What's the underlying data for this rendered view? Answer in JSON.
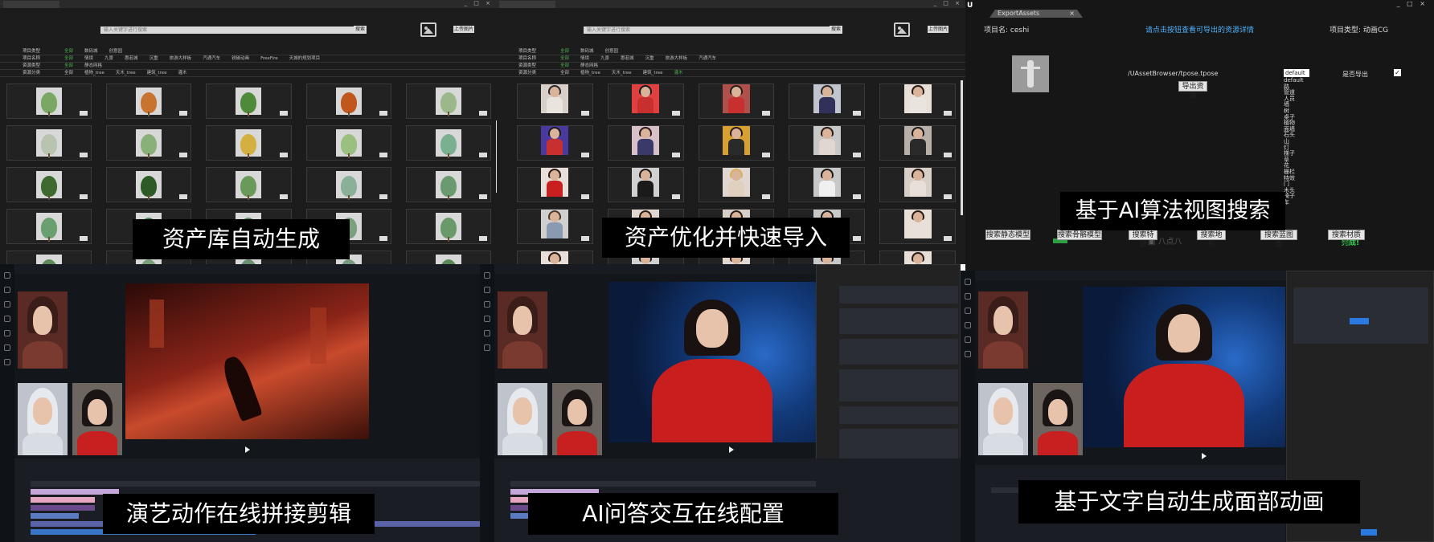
{
  "captions": {
    "c1": "资产库自动生成",
    "c2": "资产优化并快速导入",
    "c3": "基于AI算法视图搜索",
    "c4": "演艺动作在线拼接剪辑",
    "c5": "AI问答交互在线配置",
    "c6": "基于文字自动生成面部动画"
  },
  "library": {
    "search_placeholder": "输入关键字进行搜索",
    "search_button": "搜索",
    "upload_button": "上传图片",
    "filters": [
      {
        "label": "项目类型",
        "options": [
          "全部",
          "数码城",
          "创意园"
        ]
      },
      {
        "label": "项目名称",
        "options": [
          "全部",
          "情境",
          "九景",
          "惠若城",
          "沉重",
          "旅游大样板",
          "汽通汽车",
          "锐碳动画",
          "FreeFire",
          "天城的规划项目"
        ]
      },
      {
        "label": "资源类型",
        "options": [
          "全部",
          "静态网格"
        ]
      },
      {
        "label": "资源分类",
        "options": [
          "全部",
          "植物_tree",
          "天木_tree",
          "建筑_tree",
          "灌木"
        ]
      }
    ]
  },
  "export_assets": {
    "tab_title": "ExportAssets",
    "tab_close": "×",
    "project_name": "项目名: ceshi",
    "hint": "请点击按钮查看可导出的资源详情",
    "project_type": "项目类型: 动画CG",
    "asset_path": "/UAssetBrowser/tpose.tpose",
    "dropdown_value": "default",
    "dropdown_options": [
      "default",
      "路",
      "管道",
      "人员",
      "墙",
      "树",
      "桌子",
      "植物",
      "面墙",
      "石头",
      "山",
      "灯",
      "梯子",
      "草",
      "花",
      "栅栏",
      "特效",
      "门",
      "木头",
      "椅子",
      "车"
    ],
    "export_check_label": "是否导出",
    "check_mark": "✓",
    "export_button": "导出资源",
    "done_text": "完成!",
    "search_buttons": [
      "搜索静态模型",
      "搜索骨骼模型",
      "搜索特效",
      "搜索地形",
      "搜索蓝图类",
      "搜索材质包"
    ]
  },
  "window": {
    "controls": "_ □ ×"
  },
  "colors": {
    "accent_green": "#4caf50",
    "accent_blue": "#4fb3ff",
    "caption_bg": "#000000"
  }
}
